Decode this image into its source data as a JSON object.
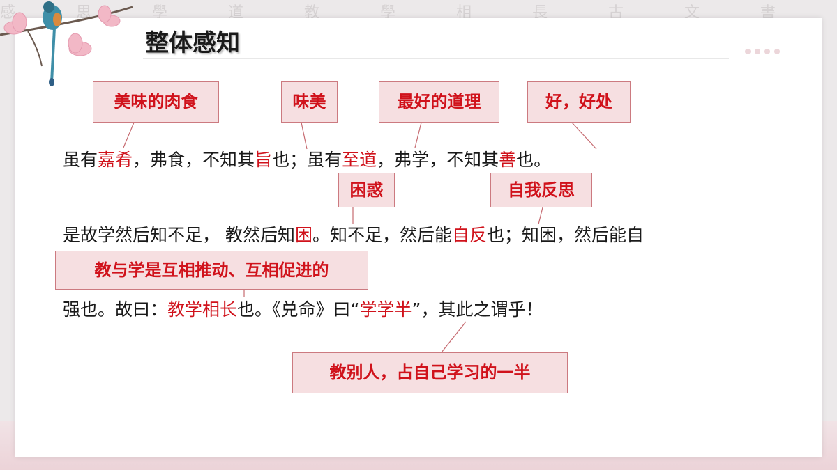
{
  "title": "整体感知",
  "background_text": "感 思 學 道 教 學 相 長 古 文 書 法",
  "annotations": {
    "meiwei_rou": "美味的肉食",
    "weimei": "味美",
    "zuihao_daoli": "最好的道理",
    "hao_haochu": "好，好处",
    "kunhuo": "困惑",
    "ziwo_fansi": "自我反思",
    "jiao_xue_hutui": "教与学是互相推动、互相促进的",
    "jiao_bieren": "教别人，占自己学习的一半"
  },
  "line1": {
    "p1": "虽有",
    "r1": "嘉肴",
    "p2": "，弗食，不知其",
    "r2": "旨",
    "p3": "也；虽有",
    "r3": "至道",
    "p4": "，弗学，不知其",
    "r4": "善",
    "p5": "也。"
  },
  "line2": {
    "p1": "是故学然后知不足，  教然后知",
    "r1": "困",
    "p2": "。知不足，然后能",
    "r2": "自反",
    "p3": "也；知困，然后能自"
  },
  "line3": {
    "p1": "强也。故曰：",
    "r1": "教学相长",
    "p2": "也。《兑命》曰“",
    "r2": "学学半",
    "p3": "”，其此之谓乎！"
  },
  "colors": {
    "accent_red": "#d0121b",
    "box_fill": "#f6dfe1",
    "box_border": "#cc7a80"
  }
}
